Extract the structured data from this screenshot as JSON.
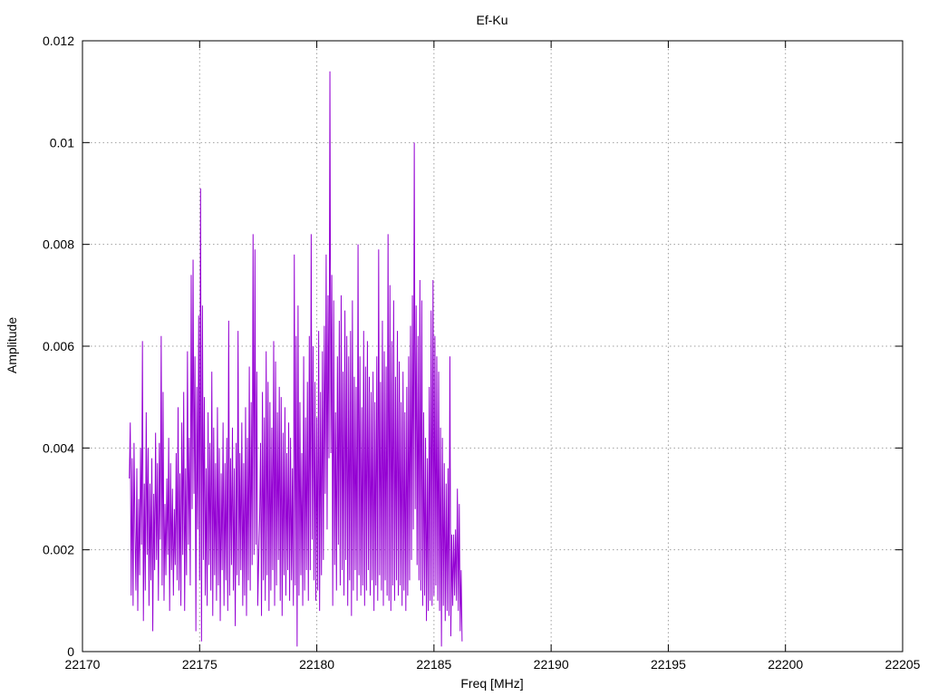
{
  "chart_data": {
    "type": "line",
    "title": "Ef-Ku",
    "xlabel": "Freq [MHz]",
    "ylabel": "Amplitude",
    "xlim": [
      22170,
      22205
    ],
    "ylim": [
      0,
      0.012
    ],
    "x_ticks": [
      "22170",
      "22175",
      "22180",
      "22185",
      "22190",
      "22195",
      "22200",
      "22205"
    ],
    "y_ticks": [
      "0",
      "0.002",
      "0.004",
      "0.006",
      "0.008",
      "0.01",
      "0.012"
    ],
    "grid": true,
    "legend": "none",
    "series": [
      {
        "color": "#9400d3",
        "x_start": 22172.0,
        "x_step": 0.04,
        "values": [
          0.0034,
          0.0045,
          0.0011,
          0.0038,
          0.0009,
          0.0041,
          0.0024,
          0.0012,
          0.0036,
          0.0008,
          0.003,
          0.0015,
          0.004,
          0.0021,
          0.0061,
          0.0006,
          0.0033,
          0.0012,
          0.0047,
          0.0019,
          0.004,
          0.0009,
          0.0033,
          0.0014,
          0.0038,
          0.0004,
          0.0031,
          0.0016,
          0.0043,
          0.0018,
          0.0037,
          0.001,
          0.0041,
          0.0022,
          0.0062,
          0.0013,
          0.0051,
          0.001,
          0.0029,
          0.0015,
          0.0034,
          0.0019,
          0.0042,
          0.0008,
          0.0037,
          0.0016,
          0.0032,
          0.0011,
          0.0028,
          0.0017,
          0.0039,
          0.0014,
          0.0048,
          0.0012,
          0.0035,
          0.0009,
          0.0045,
          0.0019,
          0.0051,
          0.0008,
          0.0036,
          0.0015,
          0.0059,
          0.0021,
          0.0042,
          0.0013,
          0.0074,
          0.0028,
          0.0077,
          0.0031,
          0.0058,
          0.0004,
          0.0052,
          0.0024,
          0.0066,
          0.0014,
          0.0091,
          0.0002,
          0.0068,
          0.0018,
          0.005,
          0.0011,
          0.0036,
          0.0009,
          0.0047,
          0.0017,
          0.0041,
          0.0012,
          0.0055,
          0.0007,
          0.0044,
          0.0015,
          0.0037,
          0.001,
          0.0048,
          0.0013,
          0.004,
          0.0006,
          0.0035,
          0.0016,
          0.0045,
          0.0009,
          0.0037,
          0.0014,
          0.0042,
          0.0008,
          0.0065,
          0.0011,
          0.0038,
          0.0017,
          0.0044,
          0.0012,
          0.0036,
          0.0005,
          0.0041,
          0.0015,
          0.0063,
          0.0013,
          0.0039,
          0.0016,
          0.0045,
          0.0009,
          0.0037,
          0.0011,
          0.0048,
          0.0007,
          0.0042,
          0.0014,
          0.0056,
          0.0012,
          0.0049,
          0.0017,
          0.0082,
          0.0019,
          0.0079,
          0.0021,
          0.0055,
          0.0009,
          0.0018,
          0.0026,
          0.0041,
          0.0007,
          0.0051,
          0.0014,
          0.0046,
          0.001,
          0.0059,
          0.0015,
          0.0053,
          0.0008,
          0.0049,
          0.0012,
          0.0044,
          0.0016,
          0.0061,
          0.0009,
          0.0057,
          0.0013,
          0.0047,
          0.0018,
          0.0052,
          0.001,
          0.005,
          0.0007,
          0.0043,
          0.0015,
          0.0048,
          0.0011,
          0.0039,
          0.0016,
          0.0045,
          0.001,
          0.0042,
          0.0014,
          0.0036,
          0.0009,
          0.0078,
          0.0013,
          0.0062,
          0.0001,
          0.0068,
          0.0011,
          0.0049,
          0.0015,
          0.0039,
          0.0009,
          0.0058,
          0.0012,
          0.0046,
          0.0016,
          0.0053,
          0.001,
          0.0062,
          0.0016,
          0.0082,
          0.0022,
          0.006,
          0.0014,
          0.0053,
          0.001,
          0.0046,
          0.0012,
          0.0063,
          0.0008,
          0.0051,
          0.0015,
          0.0059,
          0.0018,
          0.0064,
          0.0031,
          0.0078,
          0.0024,
          0.007,
          0.0038,
          0.0114,
          0.0039,
          0.0074,
          0.0009,
          0.0069,
          0.0017,
          0.0047,
          0.0012,
          0.0058,
          0.0021,
          0.0065,
          0.0013,
          0.007,
          0.0016,
          0.0055,
          0.0011,
          0.0067,
          0.0018,
          0.0062,
          0.0009,
          0.0058,
          0.0014,
          0.0063,
          0.0007,
          0.0069,
          0.0012,
          0.0054,
          0.0016,
          0.0052,
          0.001,
          0.008,
          0.0015,
          0.0058,
          0.0011,
          0.0048,
          0.0013,
          0.0063,
          0.0009,
          0.0056,
          0.0012,
          0.0061,
          0.0016,
          0.0054,
          0.0011,
          0.0051,
          0.0014,
          0.0055,
          0.0008,
          0.0049,
          0.0013,
          0.0058,
          0.001,
          0.0079,
          0.0015,
          0.0053,
          0.0012,
          0.0065,
          0.0009,
          0.0059,
          0.0014,
          0.0056,
          0.0011,
          0.0082,
          0.001,
          0.0072,
          0.0008,
          0.0061,
          0.0013,
          0.0069,
          0.001,
          0.0054,
          0.0014,
          0.0063,
          0.0011,
          0.0057,
          0.0013,
          0.0049,
          0.0009,
          0.0055,
          0.0012,
          0.0047,
          0.0008,
          0.0052,
          0.0011,
          0.0058,
          0.0014,
          0.0064,
          0.0018,
          0.007,
          0.0024,
          0.01,
          0.0028,
          0.0068,
          0.0017,
          0.0062,
          0.0014,
          0.0073,
          0.0012,
          0.0069,
          0.0009,
          0.0047,
          0.0011,
          0.0042,
          0.0006,
          0.0038,
          0.0008,
          0.0052,
          0.001,
          0.0067,
          0.0009,
          0.0073,
          0.0011,
          0.0062,
          0.0013,
          0.0058,
          0.001,
          0.0055,
          0.0008,
          0.0044,
          0.0001,
          0.0042,
          0.0009,
          0.0037,
          0.0006,
          0.0033,
          0.0008,
          0.0036,
          0.0007,
          0.0058,
          0.0003,
          0.0023,
          0.0009,
          0.0023,
          0.0011,
          0.0024,
          0.001,
          0.0032,
          0.0008,
          0.0029,
          0.0004,
          0.0016,
          0.0002
        ]
      }
    ]
  }
}
